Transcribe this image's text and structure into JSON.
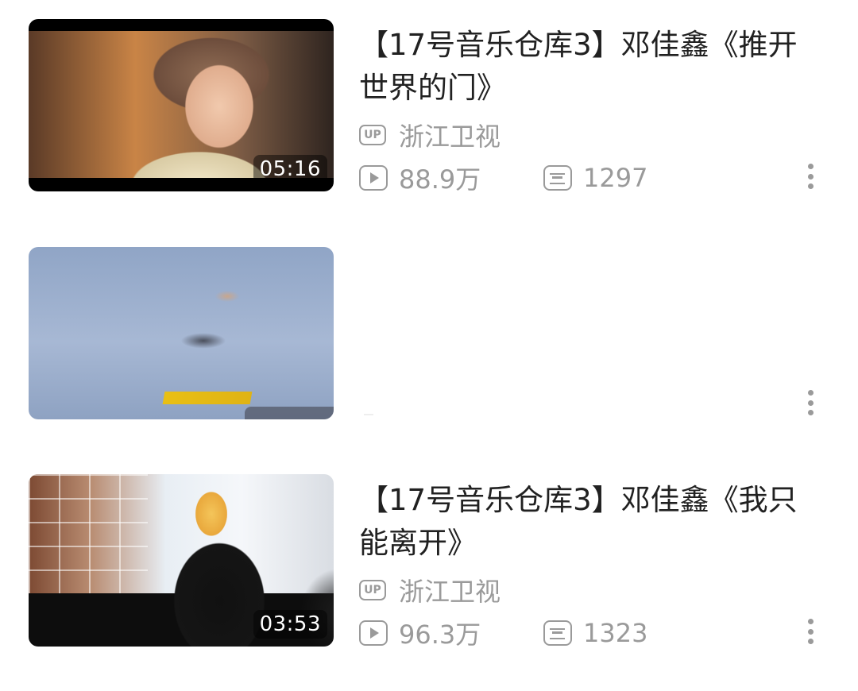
{
  "videos": [
    {
      "title": "【17号音乐仓库3】邓佳鑫《推开世界的门》",
      "duration": "05:16",
      "uploader": "浙江卫视",
      "views": "88.9万",
      "danmaku": "1297"
    },
    {
      "title": "",
      "duration": "",
      "uploader": "",
      "views": "",
      "danmaku": ""
    },
    {
      "title": "【17号音乐仓库3】邓佳鑫《我只能离开》",
      "duration": "03:53",
      "uploader": "浙江卫视",
      "views": "96.3万",
      "danmaku": "1323"
    }
  ],
  "labels": {
    "up_badge": "UP"
  },
  "icons": {
    "uploader": "up-badge-icon",
    "views": "play-count-icon",
    "danmaku": "danmaku-icon",
    "more": "more-vertical-icon"
  },
  "colors": {
    "title": "#212121",
    "meta": "#9a9a9a",
    "background": "#ffffff"
  }
}
